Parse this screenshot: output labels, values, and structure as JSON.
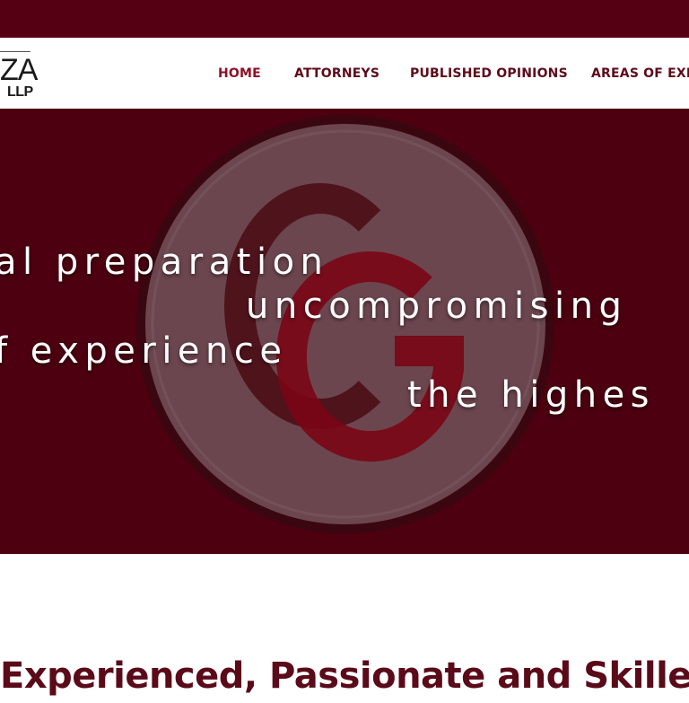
{
  "logo": {
    "main": "ZA",
    "sub": "LLP"
  },
  "nav": {
    "items": [
      {
        "label": "HOME",
        "active": true
      },
      {
        "label": "ATTORNEYS",
        "active": false
      },
      {
        "label": "PUBLISHED OPINIONS",
        "active": false
      },
      {
        "label": "AREAS OF EXPE",
        "active": false
      }
    ]
  },
  "hero": {
    "monogram": "CG",
    "lines": [
      "al preparation",
      "uncompromising",
      "f experience",
      "the highes"
    ]
  },
  "tagline": "Experienced, Passionate and Skilled",
  "colors": {
    "brand_dark": "#560013",
    "hero_bg": "#4c0010",
    "accent": "#8e1027",
    "nav_text": "#5e0a1a",
    "heading": "#5a0a18"
  }
}
